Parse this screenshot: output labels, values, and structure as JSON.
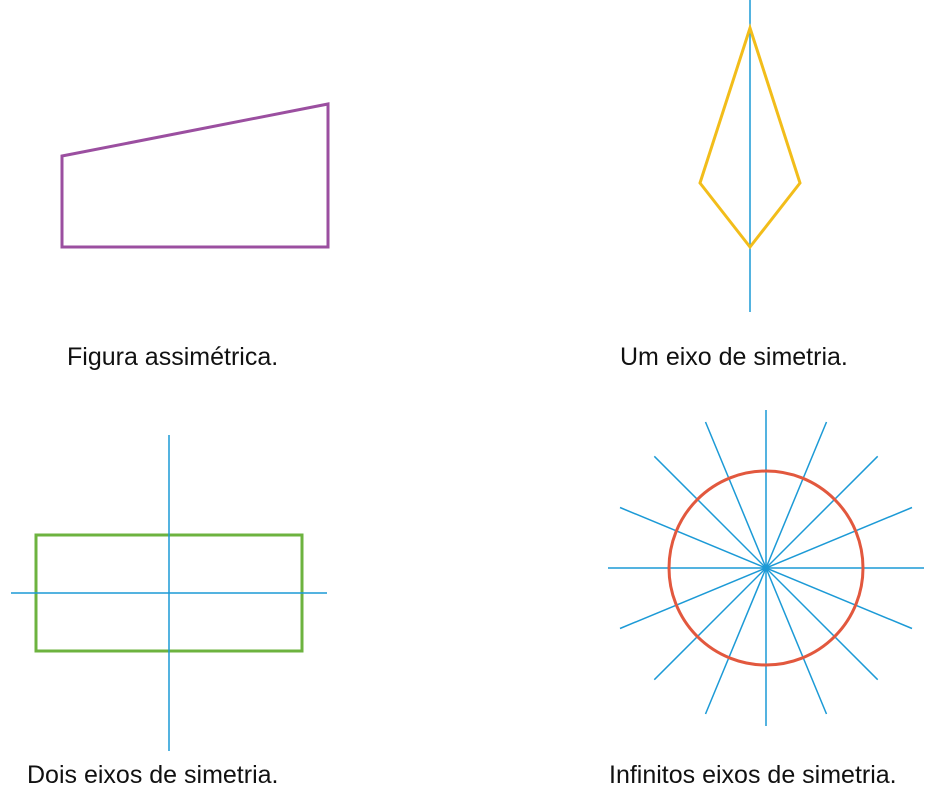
{
  "captions": {
    "asymmetric": "Figura assimétrica.",
    "one_axis": "Um eixo de simetria.",
    "two_axes": "Dois eixos de simetria.",
    "infinite_axes": "Infinitos eixos de simetria."
  },
  "colors": {
    "axis": "#1c9ad6",
    "trapezoid": "#9b4fa0",
    "kite": "#f2bd1a",
    "rectangle": "#6db33f",
    "circle": "#e2583e"
  },
  "circle_axis_count": 8
}
